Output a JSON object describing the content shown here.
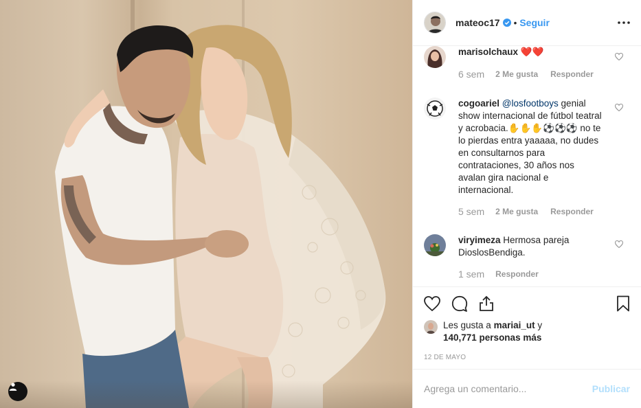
{
  "post": {
    "author": "mateoc17",
    "separator": "•",
    "follow_label": "Seguir",
    "photo_description_icon": "people-photo"
  },
  "comments": [
    {
      "user": "marisolchaux",
      "text": "❤️❤️",
      "time": "6 sem",
      "likes": "2 Me gusta",
      "reply": "Responder"
    },
    {
      "user": "cogoariel",
      "mention": "@losfootboys",
      "text": " genial show internacional de fútbol teatral y acrobacia.✋✋✋⚽⚽⚽ no te lo pierdas entra yaaaaa, no dudes en consultarnos para contrataciones, 30 años nos avalan gira nacional e internacional.",
      "time": "5 sem",
      "likes": "2 Me gusta",
      "reply": "Responder"
    },
    {
      "user": "viryimeza",
      "text": " Hermosa pareja DioslosBendiga.",
      "time": "1 sem",
      "reply": "Responder"
    }
  ],
  "likes": {
    "prefix": "Les gusta a ",
    "user": "mariai_ut",
    "middle": " y",
    "count": "140,771 personas más"
  },
  "date": "12 DE MAYO",
  "add_comment": {
    "placeholder": "Agrega un comentario...",
    "publish_label": "Publicar"
  },
  "colors": {
    "link": "#3897f0",
    "mention": "#003569",
    "publish_disabled": "#b2dffc",
    "heart_red": "#c0392b"
  }
}
